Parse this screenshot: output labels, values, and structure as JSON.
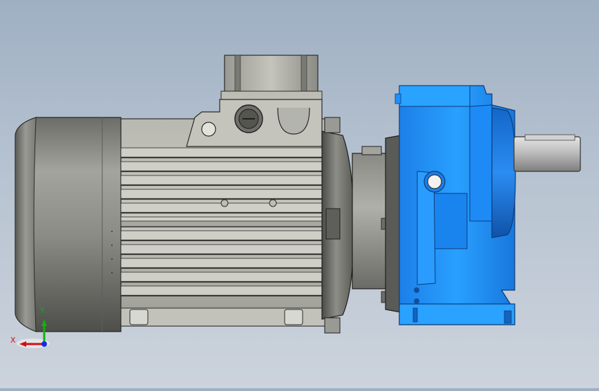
{
  "viewport": {
    "background_top": "#9fb0c3",
    "background_bottom": "#ccd3dc"
  },
  "model": {
    "motor_color": "#8a8a84",
    "gearbox_color": "#1e90ff",
    "shaft_color": "#b9b9b9"
  },
  "triad": {
    "x_label": "X",
    "y_label": "Y",
    "x_color": "#d01010",
    "y_color": "#10b010",
    "z_color": "#1030e0"
  }
}
